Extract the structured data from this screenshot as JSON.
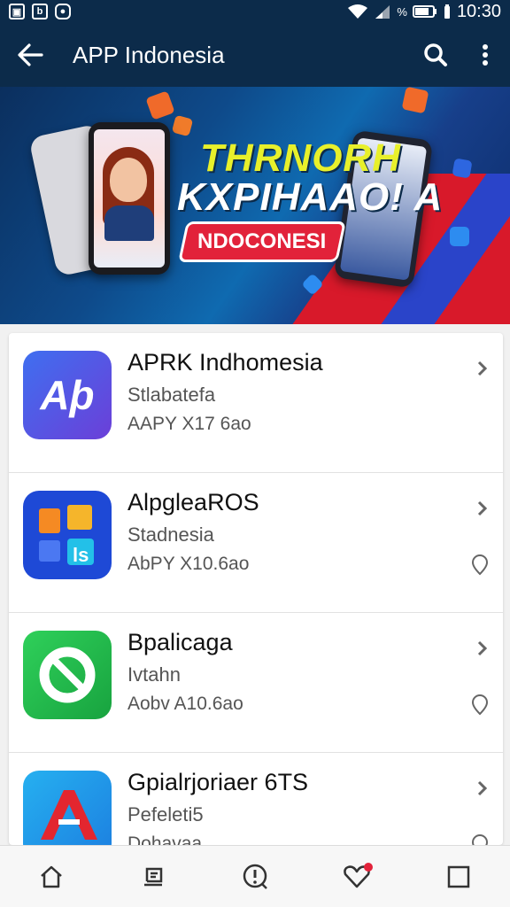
{
  "status_bar": {
    "time": "10:30",
    "left_icons": [
      "picture-icon",
      "b-icon",
      "gamepad-icon"
    ]
  },
  "app_bar": {
    "title": "APP Indonesia",
    "back_icon": "arrow-left-icon",
    "search_icon": "search-icon",
    "more_icon": "more-vert-icon"
  },
  "banner": {
    "line1": "THRNORH",
    "line2": "KXPIHAAO! A",
    "badge": "NDOCONESI"
  },
  "apps": [
    {
      "name": "APRK Indhomesia",
      "subtitle": "Stlabatefa",
      "meta": "AAPY X17 6ao",
      "icon_text": "Aþ",
      "has_pin": false
    },
    {
      "name": "AlpgleaROS",
      "subtitle": "Stadnesia",
      "meta": "AbPY X10.6ao",
      "icon_text": "",
      "has_pin": true
    },
    {
      "name": "Bpalicaga",
      "subtitle": "Ivtahn",
      "meta": "Aobv A10.6ao",
      "icon_text": "",
      "has_pin": true
    },
    {
      "name": "Gpialrjoriaer 6TS",
      "subtitle": "Pefeleti5",
      "meta": "Dohavaa",
      "icon_text": "",
      "has_pin": true
    }
  ],
  "bottom_nav": [
    "home-icon",
    "library-icon",
    "alert-icon",
    "heart-icon",
    "square-icon"
  ],
  "colors": {
    "app_bar": "#0c2b4a",
    "accent_red": "#e2223a",
    "banner_yellow": "#e8f02b"
  }
}
